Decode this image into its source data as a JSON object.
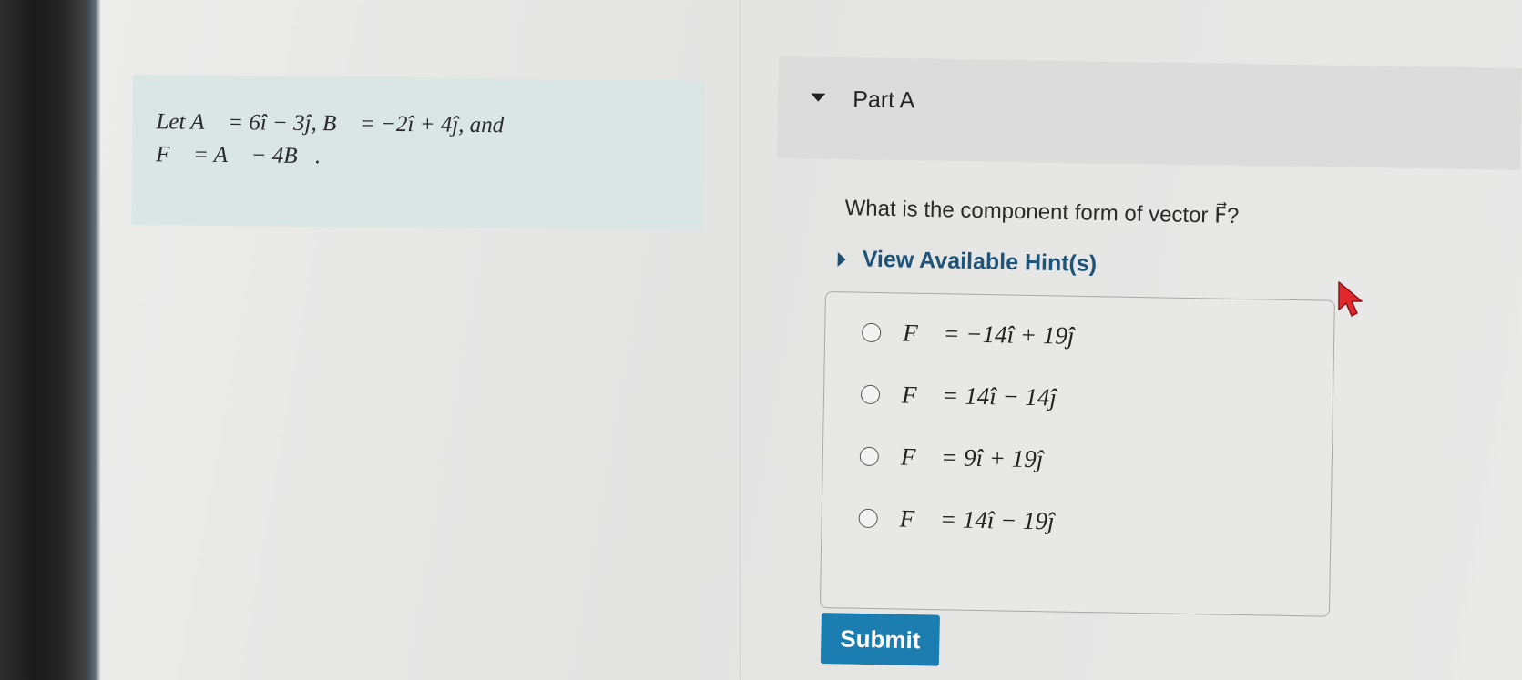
{
  "problem": {
    "line1": "Let A⃗ = 6î − 3ĵ, B⃗ = −2î + 4ĵ, and",
    "line2": "F⃗ = A⃗ − 4B⃗."
  },
  "part": {
    "title": "Part A"
  },
  "question": {
    "text": "What is the component form of vector F⃗?"
  },
  "hints": {
    "label": "View Available Hint(s)"
  },
  "options": [
    {
      "text": "F⃗ = −14î + 19ĵ"
    },
    {
      "text": "F⃗ = 14î − 14ĵ"
    },
    {
      "text": "F⃗ = 9î + 19ĵ"
    },
    {
      "text": "F⃗ = 14î − 19ĵ"
    }
  ],
  "submit": {
    "label": "Submit"
  },
  "colors": {
    "problem_bg": "#d9e6e3",
    "hint_link": "#1d5479",
    "submit_bg": "#1c7db0",
    "cursor": "#e0282d"
  }
}
